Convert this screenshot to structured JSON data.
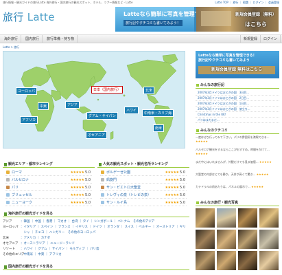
{
  "top": {
    "strip_text": "旅行情報・観光ガイドの旅行Latte 海外旅行・国内旅行の観光スポット、ホテル、ツアー情報など - Latte",
    "links": "Latte TOP ｜ 旅行 ｜ 宿題 ｜ ログイン ｜ 会員登録"
  },
  "logo": {
    "jp": "旅行",
    "en": "Latte"
  },
  "banner": {
    "line1": "Latteなら簡単に写真を管理できる！",
    "line2": "旅行記やクチコミも書いてみよう！",
    "cta_small": "新規会員登録（無料）",
    "cta_big": "はこちら"
  },
  "nav": {
    "items": [
      "海外旅行",
      "国内旅行",
      "旅行準備・持ち物"
    ],
    "right": [
      "新規登録",
      "ログイン"
    ]
  },
  "breadcrumb": "Latte > 旅行",
  "map": {
    "labels": {
      "europe": "ヨーロッパ",
      "middle_east": "中東",
      "asia": "アジア",
      "africa": "アフリカ",
      "japan": "日本（国内旅行）",
      "guam": "グアム・サイパン",
      "hawaii": "ハワイ",
      "oceania": "オセアニア",
      "north_america": "北米",
      "central_america": "中南米・カリブ海",
      "south_america": "南米"
    }
  },
  "right": {
    "banner_line1": "Latteなら簡単に写真を管理できる！",
    "banner_line2": "旅行記やクチコミも書いてみよう",
    "banner_cta": "新規会員登録 無料はこちら",
    "travelogue_head": "みんなの旅行記",
    "travelogues": [
      "2007年3月ドイツはおとぎの国　3日目...",
      "2007年3月ドイツはおとぎの国　2日目...",
      "2007年3月ドイツはおとぎの国　1日目...",
      "2007年3月ドイツはおとぎの国　旅立ち...",
      "Christmas in the UK!",
      "パリはまだまだ..."
    ],
    "reviews_head": "みんなのクチコミ",
    "reviews": [
      "一度はぜひ行ってみて下さい。パリの雰囲気を満喫できる...",
      "バルセロナ観光をするならここがおすすめ。時間をかけて...",
      "まだ中にはいれませんが、外観だけでも見る価値...",
      "大聖堂の内部はとても静か。天井が高くて驚き...",
      "カテドラルの前あたりは、パネルの展示で..."
    ],
    "photos_head": "みんなの旅行・観光写真"
  },
  "ranking_area": {
    "head": "観光エリア・都市ランキング",
    "rows": [
      {
        "name": "ローマ",
        "score": "5.0"
      },
      {
        "name": "バルセロナ",
        "score": "5.0"
      },
      {
        "name": "パリ",
        "score": "5.0"
      },
      {
        "name": "ブリュッセル",
        "score": "5.0"
      },
      {
        "name": "ニューヨーク",
        "score": "5.0"
      }
    ]
  },
  "ranking_spot": {
    "head": "人気の観光スポット・観光名所ランキング",
    "rows": [
      {
        "name": "ボルゲーゼ公園",
        "score": "5.0"
      },
      {
        "name": "凱旋門",
        "score": "5.0"
      },
      {
        "name": "サン・ピエトロ大聖堂",
        "score": "5.0"
      },
      {
        "name": "トレヴィの泉（トレビの泉）",
        "score": "5.0"
      },
      {
        "name": "サン・ルイ島",
        "score": "5.0"
      }
    ]
  },
  "stars": "★★★★★",
  "guide": {
    "head": "海外旅行の観光ガイドを見る",
    "rows": [
      {
        "k": "アジア",
        "v": "：韓国 ｜ 中国 ｜ 香港 ｜ マカオ ｜ 台湾 ｜ タイ ｜ シンガポール ｜ ベトナム　その他のアジア"
      },
      {
        "k": "ヨーロッパ",
        "v": "：イタリア ｜ スペイン ｜ フランス ｜ イギリス ｜ ドイツ ｜ オランダ ｜ スイス ｜ ベルギー ｜ オーストリア ｜ ギリ"
      },
      {
        "k": "",
        "v": "　シャ ｜ チェコ ｜ ハンガリー　その他のヨーロッパ"
      },
      {
        "k": "北米",
        "v": "：アメリカ ｜ カナダ"
      },
      {
        "k": "オセアニア",
        "v": "：オーストラリア ｜ ニュージーランド"
      },
      {
        "k": "リゾート",
        "v": "：ハワイ ｜ グアム ｜ サイパン ｜ モルディブ ｜ パリ島"
      },
      {
        "k": "その他のエリア",
        "v": "：中南米 ｜ 中東 ｜ アフリカ"
      }
    ],
    "domestic_head": "国内旅行の観光ガイドを見る"
  },
  "colors": {
    "accent": "#2266aa",
    "brand_blue": "#4da0c8",
    "green": "#9ccc3c",
    "star": "#f0a000"
  }
}
